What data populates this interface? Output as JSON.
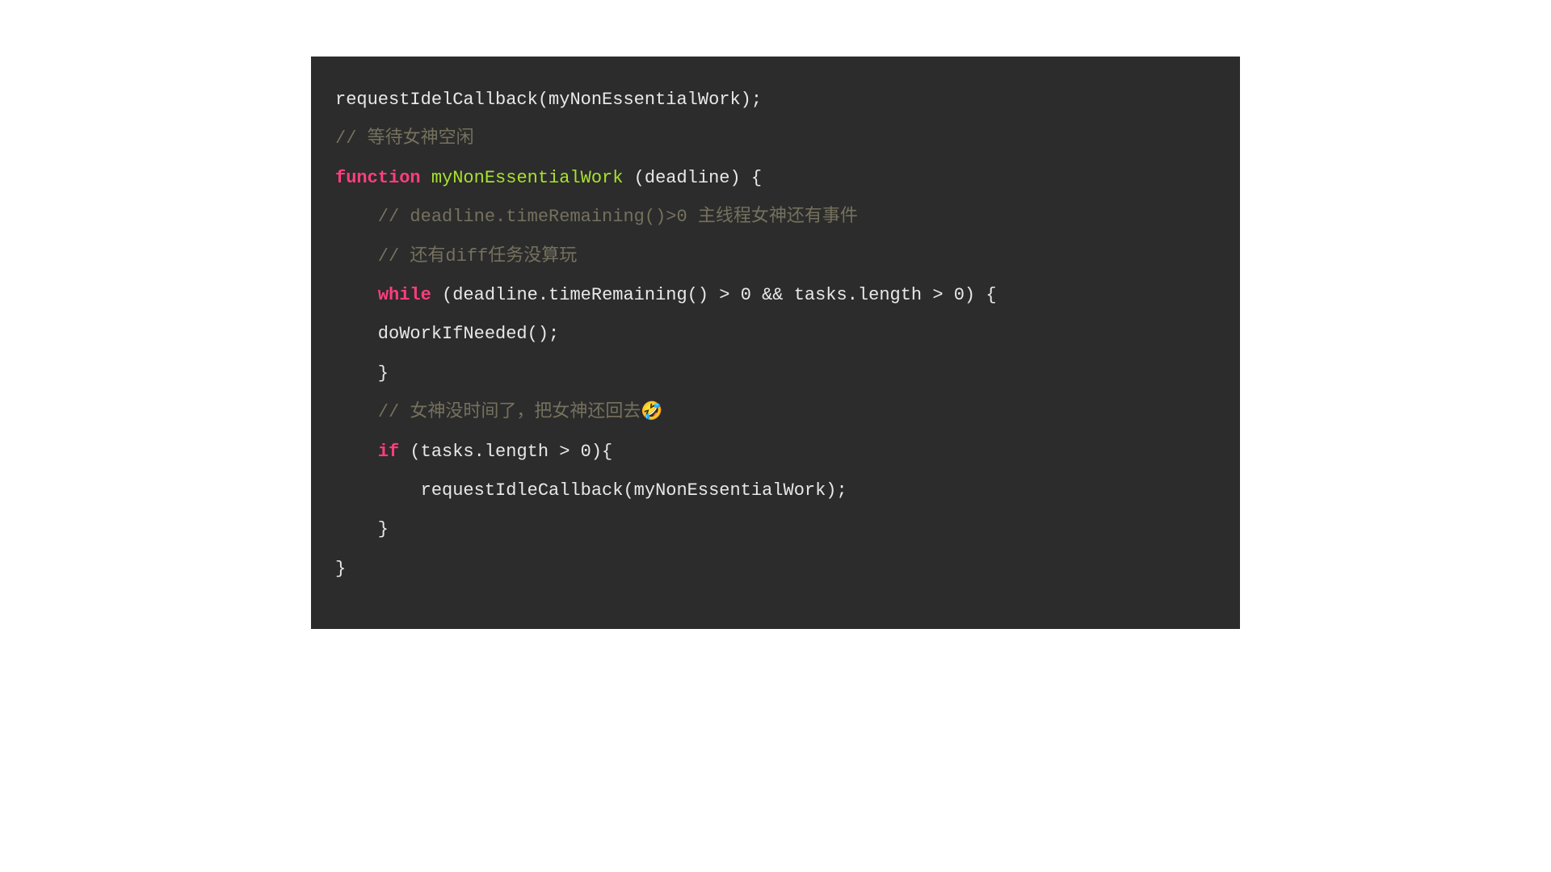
{
  "code": {
    "line1_text": "requestIdelCallback(myNonEssentialWork);",
    "line2_comment": "// 等待女神空闲",
    "line3_kw": "function",
    "line3_fn": " myNonEssentialWork",
    "line3_rest": " (deadline) {",
    "line4_comment": "    // deadline.timeRemaining()>0 主线程女神还有事件",
    "line5_comment": "    // 还有diff任务没算玩",
    "line6_indent": "    ",
    "line6_kw": "while",
    "line6_rest": " (deadline.timeRemaining() > 0 && tasks.length > 0) {",
    "line7_text": "    doWorkIfNeeded();",
    "line8_text": "    }",
    "line9_comment": "    // 女神没时间了，把女神还回去🤣",
    "line10_indent": "    ",
    "line10_kw": "if",
    "line10_rest": " (tasks.length > 0){",
    "line11_text": "        requestIdleCallback(myNonEssentialWork);",
    "line12_text": "    }",
    "line13_text": "}"
  }
}
